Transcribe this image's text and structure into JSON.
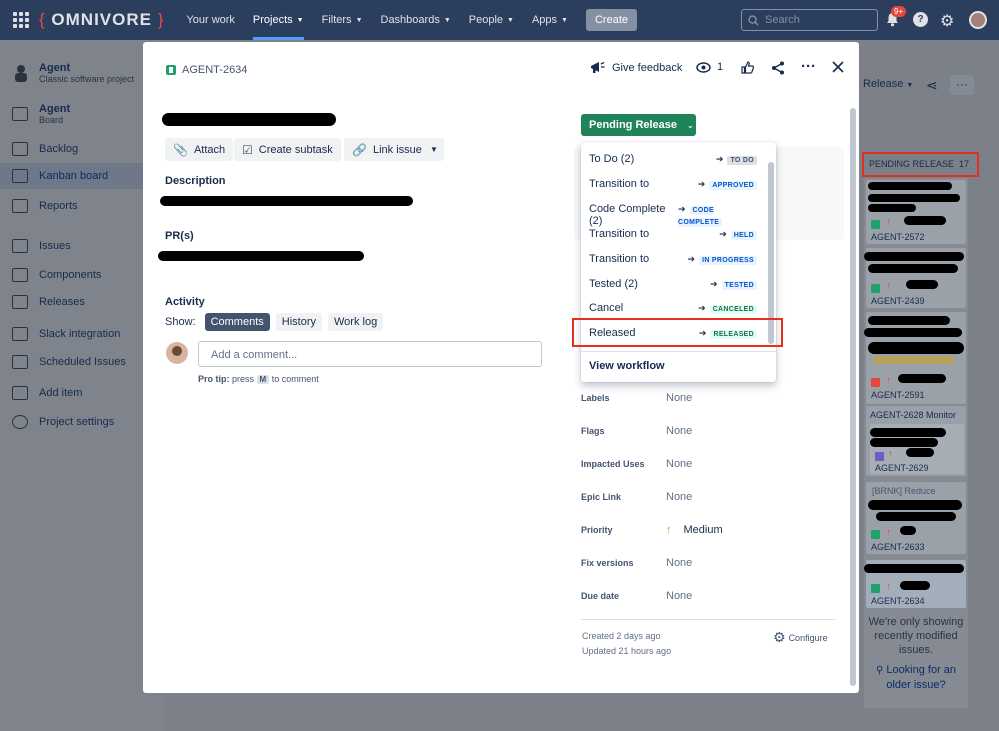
{
  "topbar": {
    "logo": "OMNIVORE",
    "nav": [
      {
        "label": "Your work",
        "caret": false,
        "active": false
      },
      {
        "label": "Projects",
        "caret": true,
        "active": true
      },
      {
        "label": "Filters",
        "caret": true,
        "active": false
      },
      {
        "label": "Dashboards",
        "caret": true,
        "active": false
      },
      {
        "label": "People",
        "caret": true,
        "active": false
      },
      {
        "label": "Apps",
        "caret": true,
        "active": false
      }
    ],
    "create_label": "Create",
    "search_placeholder": "Search",
    "notifications_badge": "9+"
  },
  "sidebar": {
    "project_name": "Agent",
    "project_type": "Classic software project",
    "board_title": "Agent",
    "board_subtitle": "Board",
    "items": [
      {
        "label": "Backlog",
        "icon": "backlog-icon"
      },
      {
        "label": "Kanban board",
        "icon": "board-icon"
      },
      {
        "label": "Reports",
        "icon": "reports-icon"
      },
      {
        "label": "Issues",
        "icon": "issues-icon"
      },
      {
        "label": "Components",
        "icon": "components-icon"
      },
      {
        "label": "Releases",
        "icon": "releases-icon"
      },
      {
        "label": "Slack integration",
        "icon": "slack-icon"
      },
      {
        "label": "Scheduled Issues",
        "icon": "scheduled-icon"
      },
      {
        "label": "Add item",
        "icon": "add-item-icon"
      },
      {
        "label": "Project settings",
        "icon": "gear-icon"
      }
    ]
  },
  "board": {
    "release_label": "Release",
    "column_title": "PENDING RELEASE",
    "column_count": "17",
    "cards": [
      {
        "key": "AGENT-2572"
      },
      {
        "key": "AGENT-2439"
      },
      {
        "key": "AGENT-2591"
      },
      {
        "key": "AGENT-2629",
        "header": "AGENT-2628 Monitor ..."
      },
      {
        "key": "AGENT-2633",
        "snippet": "[BRNK] Reduce"
      },
      {
        "key": "AGENT-2634"
      }
    ],
    "empty_message": "We're only showing recently modified issues.",
    "older_link": "Looking for an older issue?"
  },
  "modal": {
    "issue_key": "AGENT-2634",
    "feedback_label": "Give feedback",
    "watch_count": "1",
    "buttons": {
      "attach": "Attach",
      "subtask": "Create subtask",
      "link": "Link issue"
    },
    "description_label": "Description",
    "pr_label": "PR(s)",
    "activity_label": "Activity",
    "show_label": "Show:",
    "tabs": [
      "Comments",
      "History",
      "Work log"
    ],
    "comment_placeholder": "Add a comment...",
    "pro_tip_prefix": "Pro tip:",
    "pro_tip_press": "press",
    "pro_tip_key": "M",
    "pro_tip_suffix": "to comment",
    "status": "Pending Release",
    "transitions": [
      {
        "label": "To Do (2)",
        "target": "TO DO",
        "style": "gray"
      },
      {
        "label": "Transition to",
        "target": "APPROVED",
        "style": "blue"
      },
      {
        "label": "Code Complete (2)",
        "target": "CODE COMPLETE",
        "style": "blue"
      },
      {
        "label": "Transition to",
        "target": "HELD",
        "style": "blue"
      },
      {
        "label": "Transition to",
        "target": "IN PROGRESS",
        "style": "blue"
      },
      {
        "label": "Tested (2)",
        "target": "TESTED",
        "style": "blue"
      },
      {
        "label": "Cancel",
        "target": "CANCELED",
        "style": "green"
      },
      {
        "label": "Released",
        "target": "RELEASED",
        "style": "green"
      }
    ],
    "view_workflow": "View workflow",
    "fields": [
      {
        "label": "Labels",
        "value": "None"
      },
      {
        "label": "Flags",
        "value": "None"
      },
      {
        "label": "Impacted Uses",
        "value": "None"
      },
      {
        "label": "Epic Link",
        "value": "None"
      },
      {
        "label": "Priority",
        "value": "Medium"
      },
      {
        "label": "Fix versions",
        "value": "None"
      },
      {
        "label": "Due date",
        "value": "None"
      }
    ],
    "created": "Created 2 days ago",
    "updated": "Updated 21 hours ago",
    "configure": "Configure"
  },
  "colors": {
    "topbar": "#2c3e5d",
    "status_green": "#1f845a",
    "highlight_red": "#e4301f",
    "link_blue": "#0055cc"
  }
}
